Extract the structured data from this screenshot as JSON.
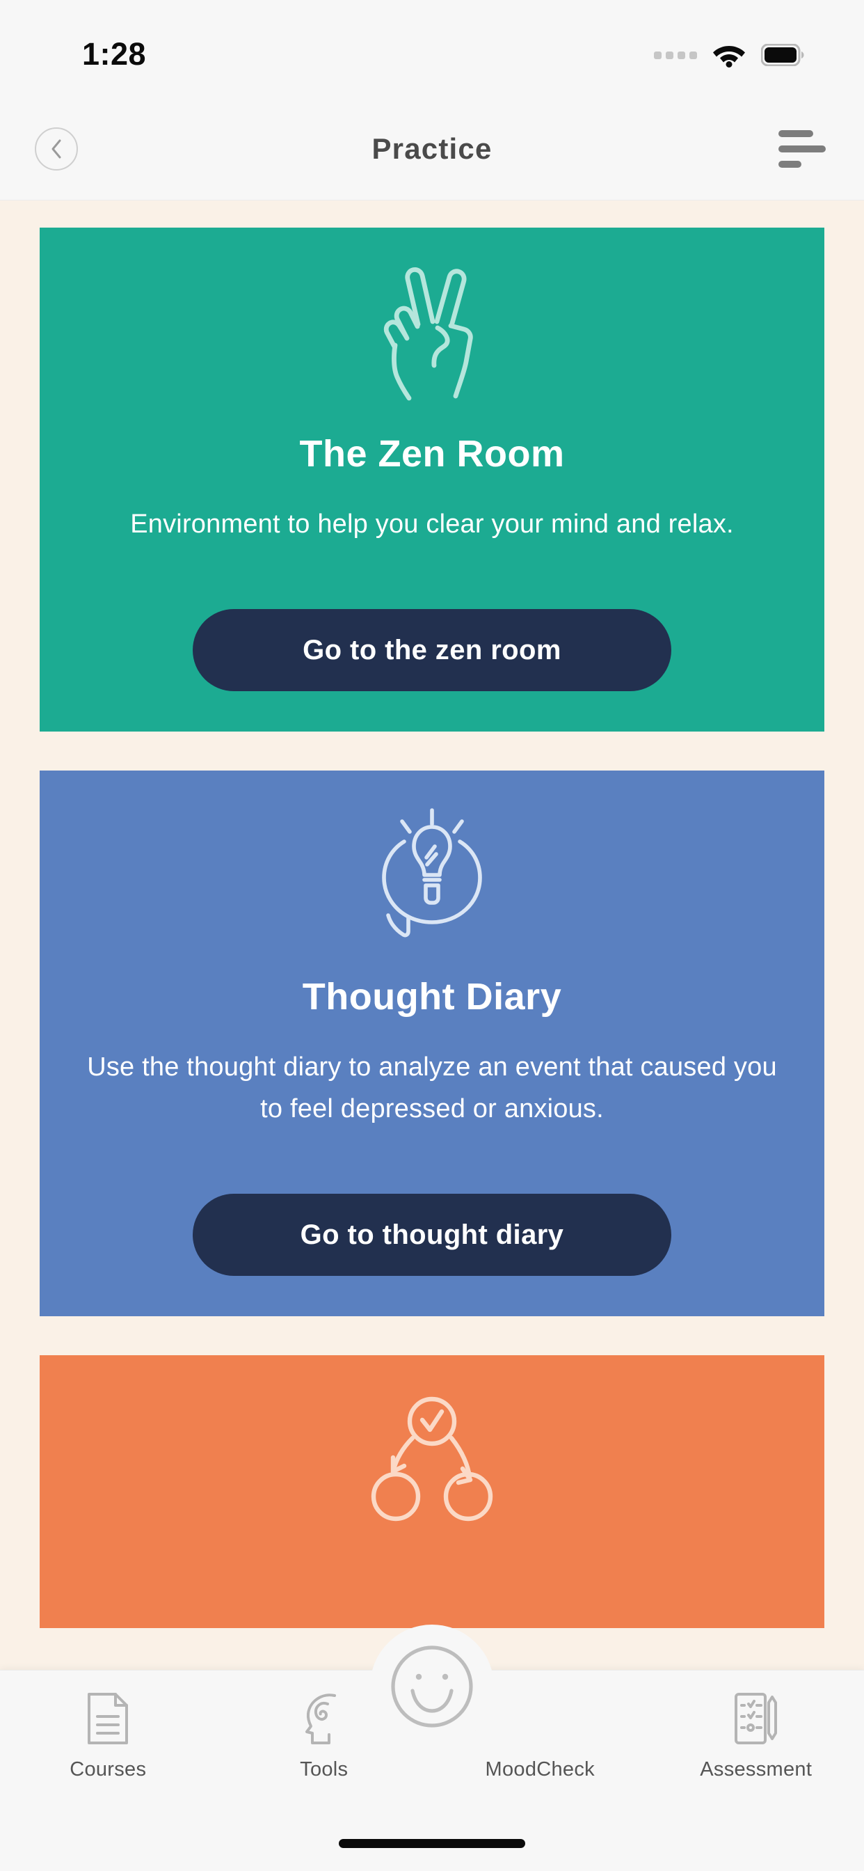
{
  "status_bar": {
    "time": "1:28",
    "signal_icon": "signal-dots-icon",
    "wifi_icon": "wifi-icon",
    "battery_icon": "battery-full-icon"
  },
  "header": {
    "title": "Practice",
    "back_icon": "chevron-left-icon",
    "menu_icon": "hamburger-menu-icon"
  },
  "cards": [
    {
      "id": "zen-room",
      "icon": "peace-hand-icon",
      "title": "The Zen Room",
      "description": "Environment to help you clear your mind and relax.",
      "button_label": "Go to the zen room",
      "background_color": "#1cab92"
    },
    {
      "id": "thought-diary",
      "icon": "lightbulb-speech-bubble-icon",
      "title": "Thought Diary",
      "description": "Use the thought diary to analyze an event that caused you to feel depressed or anxious.",
      "button_label": "Go to thought diary",
      "background_color": "#5a80c0"
    },
    {
      "id": "cycle",
      "icon": "cycle-checkmark-icon",
      "title": "",
      "description": "",
      "button_label": "",
      "background_color": "#f0804f"
    }
  ],
  "tab_bar": {
    "items": [
      {
        "label": "Courses",
        "icon": "document-icon"
      },
      {
        "label": "Tools",
        "icon": "head-spiral-icon"
      },
      {
        "label": "MoodCheck",
        "icon": "smiley-face-icon"
      },
      {
        "label": "Assessment",
        "icon": "clipboard-checklist-icon"
      }
    ]
  },
  "colors": {
    "zen_green": "#1cab92",
    "diary_blue": "#5a80c0",
    "cycle_orange": "#f0804f",
    "button_navy": "#22304f",
    "page_background": "#faf1e7",
    "chrome_background": "#f7f7f7"
  }
}
